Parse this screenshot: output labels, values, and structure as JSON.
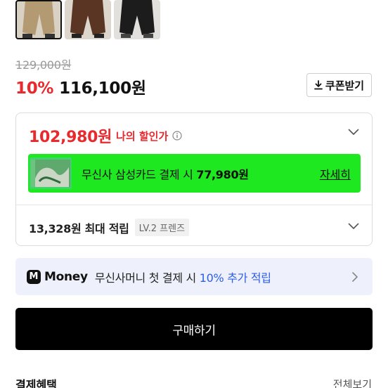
{
  "thumbnails": [
    {
      "name": "beige-pants",
      "selected": true
    },
    {
      "name": "brown-pants",
      "selected": false
    },
    {
      "name": "black-pants",
      "selected": false
    }
  ],
  "pricing": {
    "original_price": "129,000원",
    "discount_rate": "10%",
    "final_price": "116,100원",
    "coupon_label": "쿠폰받기"
  },
  "benefit": {
    "my_price": "102,980원",
    "my_price_label": "나의 할인가",
    "card_promo_text": "무신사 삼성카드 결제 시 ",
    "card_promo_price": "77,980원",
    "card_promo_link": "자세히",
    "points_text": "13,328원 최대 적립",
    "level_badge": "LV.2 프렌즈"
  },
  "money_banner": {
    "logo": "M",
    "brand": "Money",
    "text_prefix": "무신사머니 첫 결제 시 ",
    "highlight": "10% 추가 적립"
  },
  "buy_button": "구매하기",
  "payment_section": {
    "title": "결제혜택",
    "view_all": "전체보기"
  },
  "colors": {
    "accent_red": "#e8292e",
    "promo_green": "#1ee81f",
    "money_blue": "#2c5ee8",
    "banner_bg": "#eef1fb"
  }
}
